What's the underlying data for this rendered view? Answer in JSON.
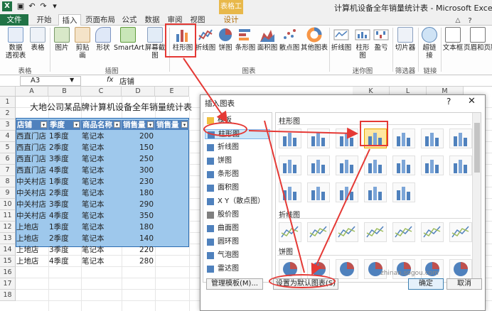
{
  "window": {
    "title": "计算机设备全年销量统计表 - Microsoft Excel",
    "context_tab": "表格工具"
  },
  "tabs": [
    "文件",
    "开始",
    "插入",
    "页面布局",
    "公式",
    "数据",
    "审阅",
    "视图",
    "设计"
  ],
  "ribbon": {
    "tables": [
      "数据\n透视表",
      "表格"
    ],
    "illustrations": [
      "图片",
      "剪贴画",
      "形状",
      "SmartArt",
      "屏幕截图"
    ],
    "charts": [
      "柱形图",
      "折线图",
      "饼图",
      "条形图",
      "面积图",
      "散点图",
      "其他图表"
    ],
    "sparklines": [
      "折线图",
      "柱形图",
      "盈亏"
    ],
    "filter": [
      "切片器"
    ],
    "links": [
      "超链接"
    ],
    "text": [
      "文本框",
      "页眉和页脚"
    ],
    "groups": [
      "表格",
      "插图",
      "图表",
      "迷你图",
      "筛选器",
      "链接"
    ]
  },
  "formula": {
    "cell_ref": "A3",
    "fx": "fx",
    "content": "店铺"
  },
  "columns": [
    "A",
    "B",
    "C",
    "D",
    "E"
  ],
  "more_columns": [
    "K",
    "L",
    "M"
  ],
  "rows": [
    "1",
    "2",
    "3",
    "4",
    "5",
    "6",
    "7",
    "8",
    "9",
    "10",
    "11",
    "12",
    "13",
    "14",
    "15",
    "16",
    "17",
    "18"
  ],
  "sheet_title": "大地公司某品牌计算机设备全年销量统计表",
  "table": {
    "headers": [
      "店铺",
      "季度",
      "商品名称",
      "销售量",
      "销售量"
    ],
    "rows": [
      [
        "西直门店",
        "1季度",
        "笔记本",
        "200"
      ],
      [
        "西直门店",
        "2季度",
        "笔记本",
        "150"
      ],
      [
        "西直门店",
        "3季度",
        "笔记本",
        "250"
      ],
      [
        "西直门店",
        "4季度",
        "笔记本",
        "300"
      ],
      [
        "中关村店",
        "1季度",
        "笔记本",
        "230"
      ],
      [
        "中关村店",
        "2季度",
        "笔记本",
        "180"
      ],
      [
        "中关村店",
        "3季度",
        "笔记本",
        "290"
      ],
      [
        "中关村店",
        "4季度",
        "笔记本",
        "350"
      ],
      [
        "上地店",
        "1季度",
        "笔记本",
        "180"
      ],
      [
        "上地店",
        "2季度",
        "笔记本",
        "140"
      ],
      [
        "上地店",
        "3季度",
        "笔记本",
        "220"
      ],
      [
        "上地店",
        "4季度",
        "笔记本",
        "280"
      ]
    ]
  },
  "dialog": {
    "title": "插入图表",
    "help": "?",
    "close": "✕",
    "types": [
      "模板",
      "柱形图",
      "折线图",
      "饼图",
      "条形图",
      "面积图",
      "X Y（散点图）",
      "股价图",
      "曲面图",
      "圆环图",
      "气泡图",
      "雷达图"
    ],
    "sections": [
      "柱形图",
      "折线图",
      "饼图"
    ],
    "buttons": {
      "manage": "管理模板(M)...",
      "set_default": "设置为默认图表(S)",
      "ok": "确定",
      "cancel": "取消"
    }
  },
  "watermark": "zhinan.sogou.com",
  "colors": {
    "excel_green": "#217346",
    "selection_blue": "#9ec8ec",
    "header_blue": "#4f81bd",
    "highlight_red": "#e53935"
  }
}
